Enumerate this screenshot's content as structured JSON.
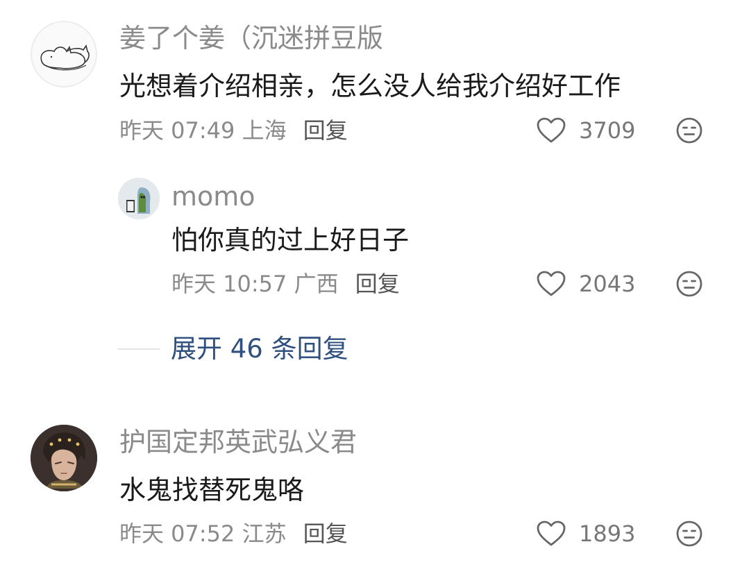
{
  "comments": [
    {
      "username": "姜了个姜（沉迷拼豆版",
      "text": "光想着介绍相亲，怎么没人给我介绍好工作",
      "time": "昨天 07:49",
      "location": "上海",
      "reply_label": "回复",
      "likes": "3709",
      "avatar_icon": "cats-sketch-avatar",
      "reply": {
        "username": "momo",
        "text": "怕你真的过上好日子",
        "time": "昨天 10:57",
        "location": "广西",
        "reply_label": "回复",
        "likes": "2043",
        "avatar_icon": "figurine-avatar"
      },
      "expand_label": "展开 46 条回复"
    },
    {
      "username": "护国定邦英武弘义君",
      "text": "水鬼找替死鬼咯",
      "time": "昨天 07:52",
      "location": "江苏",
      "reply_label": "回复",
      "likes": "1893",
      "avatar_icon": "anime-character-avatar"
    }
  ],
  "colors": {
    "username": "#8a8a8a",
    "content": "#1a1a1a",
    "expand_link": "#2f4f7f",
    "icon": "#666666"
  }
}
